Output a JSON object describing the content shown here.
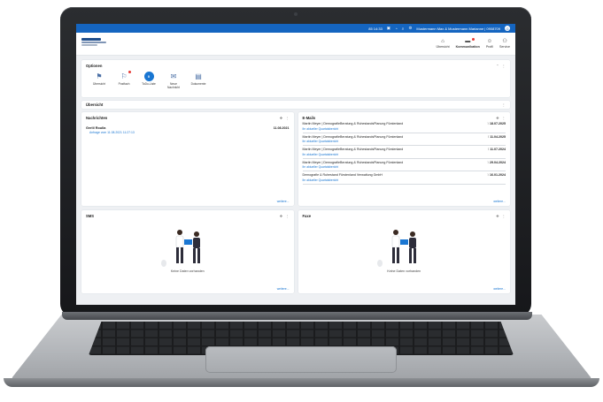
{
  "topbar": {
    "badge_count": "85 14:33",
    "user": "Mustermann Max & Mustermann Marianne | 0908709",
    "user_initial": "G"
  },
  "header": {
    "nav": [
      {
        "label": "Übersicht",
        "icon": "home-icon"
      },
      {
        "label": "Kommunikation",
        "icon": "chat-icon",
        "active": true
      },
      {
        "label": "Profil",
        "icon": "person-icon"
      },
      {
        "label": "Service",
        "icon": "group-icon"
      }
    ]
  },
  "optionen": {
    "title": "Optionen",
    "items": [
      {
        "label": "Übersicht",
        "icon": "overview-icon"
      },
      {
        "label": "Postfach",
        "icon": "mailbox-icon"
      },
      {
        "label": "ToDo-Liste",
        "icon": "todo-icon",
        "value": "0"
      },
      {
        "label": "Neue Nachricht",
        "icon": "new-message-icon"
      },
      {
        "label": "Dokumente",
        "icon": "documents-icon"
      }
    ]
  },
  "uebersicht": {
    "title": "Übersicht"
  },
  "nachrichten": {
    "title": "Nachrichten",
    "items": [
      {
        "name": "Gerlil Roulla",
        "date": "11.08.2021",
        "sub": "Anfrage vom 11.08.2021 11:27:13"
      }
    ],
    "more": "weitere..."
  },
  "emails": {
    "title": "E-Mails",
    "items": [
      {
        "from": "Martin Meyer | DemografieBeratung & RuhestandsPlanung Fürstenland",
        "date": "18.07.2025",
        "sub": "Ihr aktueller Quartalsbericht"
      },
      {
        "from": "Martin Meyer | DemografieBeratung & RuhestandsPlanung Fürstenland",
        "date": "11.04.2025",
        "sub": "Ihr aktueller Quartalsbericht"
      },
      {
        "from": "Martin Meyer | DemografieBeratung & RuhestandsPlanung Fürstenland",
        "date": "11.07.2024",
        "sub": "Ihr aktueller Quartalsbericht"
      },
      {
        "from": "Martin Meyer | DemografieBeratung & RuhestandsPlanung Fürstenland",
        "date": "29.04.2024",
        "sub": "Ihr aktueller Quartalsbericht"
      },
      {
        "from": "Demografie & Ruhestand Fürstenland Verwaltung GmbH",
        "date": "16.01.2024",
        "sub": "Ihr aktueller Quartalsbericht"
      }
    ],
    "more": "weitere..."
  },
  "sms": {
    "title": "SMS",
    "empty": "Keine Daten vorhanden",
    "more": "weitere..."
  },
  "faxe": {
    "title": "Faxe",
    "empty": "Keine Daten vorhanden",
    "more": "weitere..."
  },
  "colors": {
    "accent": "#1565c0",
    "link": "#1976d2",
    "badge": "#e53935"
  }
}
